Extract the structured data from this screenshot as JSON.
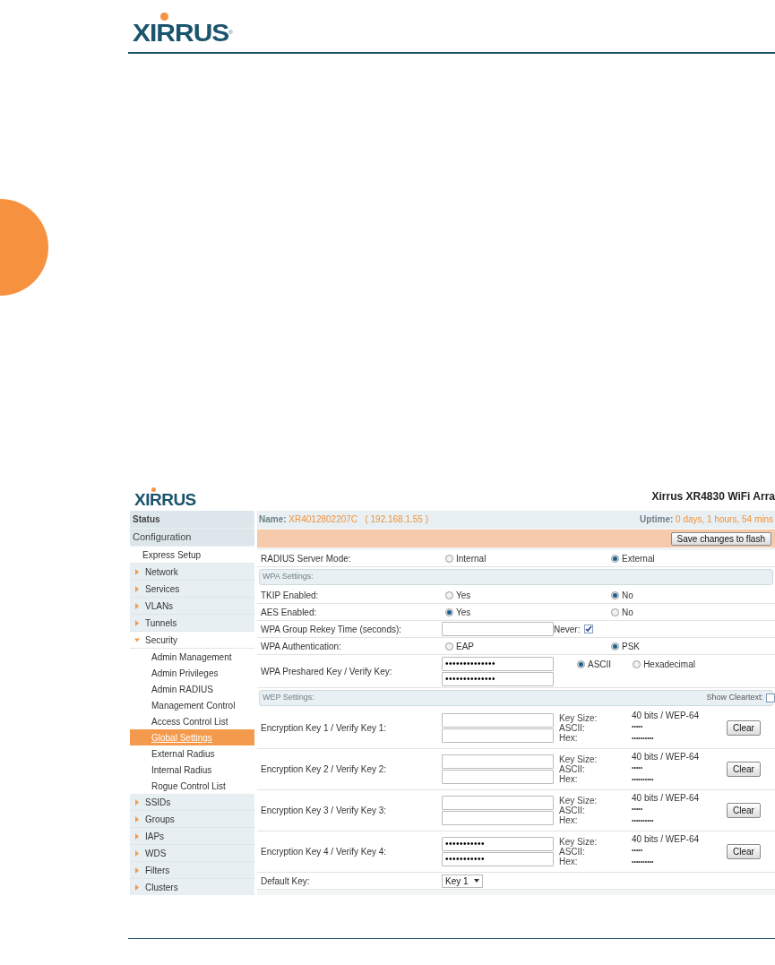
{
  "page_header": {
    "logo": "XIRRUS",
    "logo_mark": "®"
  },
  "screenshot": {
    "logo": "XIRRUS",
    "title": "Xirrus XR4830 WiFi Arra",
    "sidebar": [
      {
        "kind": "header",
        "label": "Status"
      },
      {
        "kind": "header",
        "label": "Configuration"
      },
      {
        "kind": "link",
        "label": "Express Setup"
      },
      {
        "kind": "group",
        "label": "Network",
        "expanded": false
      },
      {
        "kind": "group",
        "label": "Services",
        "expanded": false
      },
      {
        "kind": "group",
        "label": "VLANs",
        "expanded": false
      },
      {
        "kind": "group",
        "label": "Tunnels",
        "expanded": false
      },
      {
        "kind": "group",
        "label": "Security",
        "expanded": true,
        "children": [
          {
            "label": "Admin Management",
            "selected": false
          },
          {
            "label": "Admin Privileges",
            "selected": false
          },
          {
            "label": "Admin RADIUS",
            "selected": false
          },
          {
            "label": "Management Control",
            "selected": false
          },
          {
            "label": "Access Control List",
            "selected": false
          },
          {
            "label": "Global Settings",
            "selected": true
          },
          {
            "label": "External Radius",
            "selected": false
          },
          {
            "label": "Internal Radius",
            "selected": false
          },
          {
            "label": "Rogue Control List",
            "selected": false
          }
        ]
      },
      {
        "kind": "group",
        "label": "SSIDs",
        "expanded": false
      },
      {
        "kind": "group",
        "label": "Groups",
        "expanded": false
      },
      {
        "kind": "group",
        "label": "IAPs",
        "expanded": false
      },
      {
        "kind": "group",
        "label": "WDS",
        "expanded": false
      },
      {
        "kind": "group",
        "label": "Filters",
        "expanded": false
      },
      {
        "kind": "group",
        "label": "Clusters",
        "expanded": false
      }
    ],
    "info_bar": {
      "name_label": "Name:",
      "name": "XR4012802207C",
      "ip": "( 192.168.1.55 )",
      "uptime_label": "Uptime:",
      "uptime": "0 days, 1 hours, 54 mins"
    },
    "save_button": "Save changes to flash",
    "rows": [
      {
        "kind": "radio",
        "label": "RADIUS Server Mode:",
        "options": [
          {
            "label": "Internal",
            "selected": false
          },
          {
            "label": "External",
            "selected": true
          }
        ]
      },
      {
        "kind": "section",
        "label": "WPA Settings:"
      },
      {
        "kind": "radio",
        "label": "TKIP Enabled:",
        "options": [
          {
            "label": "Yes",
            "selected": false
          },
          {
            "label": "No",
            "selected": true
          }
        ]
      },
      {
        "kind": "radio",
        "label": "AES Enabled:",
        "options": [
          {
            "label": "Yes",
            "selected": true
          },
          {
            "label": "No",
            "selected": false
          }
        ]
      },
      {
        "kind": "rekey",
        "label": "WPA Group Rekey Time (seconds):",
        "never_label": "Never:",
        "never_checked": true
      },
      {
        "kind": "radio",
        "label": "WPA Authentication:",
        "options": [
          {
            "label": "EAP",
            "selected": false
          },
          {
            "label": "PSK",
            "selected": true
          }
        ]
      },
      {
        "kind": "psk",
        "label": "WPA Preshared Key / Verify Key:",
        "key": "••••••••••••••",
        "verify": "••••••••••••••",
        "options": [
          {
            "label": "ASCII",
            "selected": true
          },
          {
            "label": "Hexadecimal",
            "selected": false
          }
        ]
      },
      {
        "kind": "section",
        "label": "WEP Settings:",
        "cleartext_label": "Show Cleartext:",
        "cleartext_checked": false
      },
      {
        "kind": "wep",
        "label": "Encryption Key 1 / Verify Key 1:",
        "key_size_label": "Key Size:",
        "ascii_label": "ASCII:",
        "hex_label": "Hex:",
        "key_size": "40 bits / WEP-64",
        "ascii": "•••••",
        "hex": "••••••••••",
        "button": "Clear"
      },
      {
        "kind": "wep",
        "label": "Encryption Key 2 / Verify Key 2:",
        "key_size_label": "Key Size:",
        "ascii_label": "ASCII:",
        "hex_label": "Hex:",
        "key_size": "40 bits / WEP-64",
        "ascii": "•••••",
        "hex": "••••••••••",
        "button": "Clear"
      },
      {
        "kind": "wep",
        "label": "Encryption Key 3 / Verify Key 3:",
        "key_size_label": "Key Size:",
        "ascii_label": "ASCII:",
        "hex_label": "Hex:",
        "key_size": "40 bits / WEP-64",
        "ascii": "•••••",
        "hex": "••••••••••",
        "button": "Clear"
      },
      {
        "kind": "wep",
        "label": "Encryption Key 4 / Verify Key 4:",
        "key": "•••••••••••",
        "verify": "•••••••••••",
        "key_size_label": "Key Size:",
        "ascii_label": "ASCII:",
        "hex_label": "Hex:",
        "key_size": "40 bits / WEP-64",
        "ascii": "•••••",
        "hex": "••••••••••",
        "button": "Clear"
      },
      {
        "kind": "select",
        "label": "Default Key:",
        "value": "Key 1"
      }
    ]
  }
}
